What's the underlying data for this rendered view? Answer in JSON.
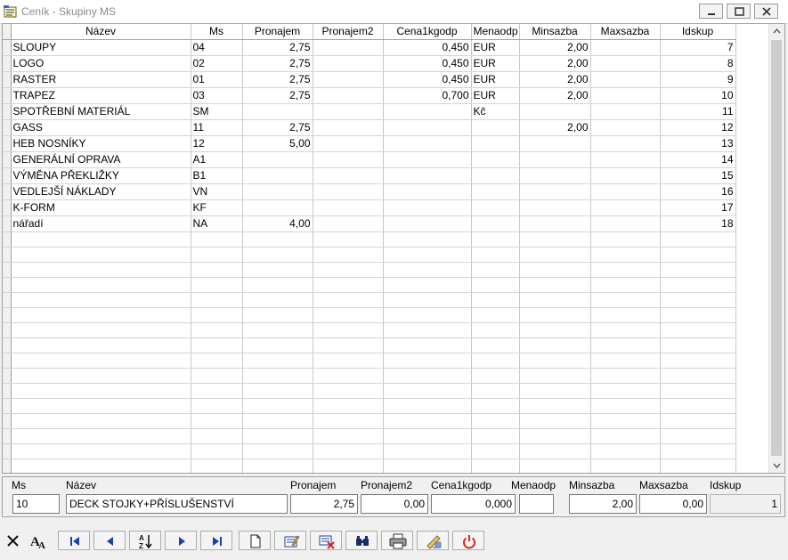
{
  "window": {
    "title": "Ceník - Skupiny MS"
  },
  "grid": {
    "columns": [
      "Název",
      "Ms",
      "Pronajem",
      "Pronajem2",
      "Cena1kgodp",
      "Menaodp",
      "Minsazba",
      "Maxsazba",
      "Idskup"
    ],
    "rows": [
      [
        "SLOUPY",
        "04",
        "2,75",
        "",
        "0,450",
        "EUR",
        "2,00",
        "",
        "7"
      ],
      [
        "LOGO",
        "02",
        "2,75",
        "",
        "0,450",
        "EUR",
        "2,00",
        "",
        "8"
      ],
      [
        "RASTER",
        "01",
        "2,75",
        "",
        "0,450",
        "EUR",
        "2,00",
        "",
        "9"
      ],
      [
        "TRAPEZ",
        "03",
        "2,75",
        "",
        "0,700",
        "EUR",
        "2,00",
        "",
        "10"
      ],
      [
        "SPOTŘEBNÍ MATERIÁL",
        "SM",
        "",
        "",
        "",
        "Kč",
        "",
        "",
        "11"
      ],
      [
        "GASS",
        "11",
        "2,75",
        "",
        "",
        "",
        "2,00",
        "",
        "12"
      ],
      [
        "HEB NOSNÍKY",
        "12",
        "5,00",
        "",
        "",
        "",
        "",
        "",
        "13"
      ],
      [
        "GENERÁLNÍ OPRAVA",
        "A1",
        "",
        "",
        "",
        "",
        "",
        "",
        "14"
      ],
      [
        "VÝMĚNA PŘEKLIŽKY",
        "B1",
        "",
        "",
        "",
        "",
        "",
        "",
        "15"
      ],
      [
        "VEDLEJŠÍ NÁKLADY",
        "VN",
        "",
        "",
        "",
        "",
        "",
        "",
        "16"
      ],
      [
        "K-FORM",
        "KF",
        "",
        "",
        "",
        "",
        "",
        "",
        "17"
      ],
      [
        "nářadí",
        "NA",
        "4,00",
        "",
        "",
        "",
        "",
        "",
        "18"
      ]
    ]
  },
  "detail": {
    "ms": {
      "label": "Ms",
      "value": "10"
    },
    "nazev": {
      "label": "Název",
      "value": "DECK STOJKY+PŘÍSLUŠENSTVÍ"
    },
    "pronajem": {
      "label": "Pronajem",
      "value": "2,75"
    },
    "pronajem2": {
      "label": "Pronajem2",
      "value": "0,00"
    },
    "cena1kgodp": {
      "label": "Cena1kgodp",
      "value": "0,000"
    },
    "menaodp": {
      "label": "Menaodp",
      "value": ""
    },
    "minsazba": {
      "label": "Minsazba",
      "value": "2,00"
    },
    "maxsazba": {
      "label": "Maxsazba",
      "value": "0,00"
    },
    "idskup": {
      "label": "Idskup",
      "value": "1"
    }
  },
  "toolbar": {
    "icons": [
      "close-icon",
      "font-icon",
      "first-record-icon",
      "previous-record-icon",
      "sort-az-icon",
      "next-record-icon",
      "last-record-icon",
      "new-record-icon",
      "edit-record-icon",
      "delete-record-icon",
      "find-icon",
      "print-icon",
      "settings-icon",
      "exit-icon"
    ]
  },
  "colors": {
    "exit": "#d9261c",
    "nav_blue": "#1c3fa8"
  }
}
